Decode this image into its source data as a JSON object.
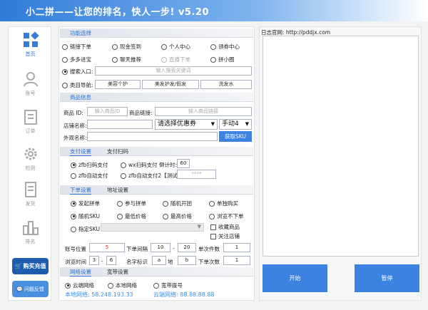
{
  "window": {
    "title": "小二拼——让您的排名，快人一步! v5.20"
  },
  "sidebar": {
    "items": [
      {
        "label": "首页",
        "icon": "home-grid-icon"
      },
      {
        "label": "账号",
        "icon": "user-icon"
      },
      {
        "label": "订单",
        "icon": "order-icon"
      },
      {
        "label": "检测",
        "icon": "gear-icon"
      },
      {
        "label": "发货",
        "icon": "document-icon"
      },
      {
        "label": "排名",
        "icon": "ranking-icon"
      }
    ],
    "buy_button": "购买充值",
    "feedback_button": "问题反馈"
  },
  "function_section": {
    "title": "功能选择",
    "options": [
      "链接下单",
      "现金签到",
      "个人中心",
      "领券中心",
      "多多进宝",
      "聊天推荐",
      "直播下单",
      "拼小圈"
    ],
    "search_entry_label": "搜索入口:",
    "search_placeholder": "输入搜索关键词",
    "category_nav_label": "类目导航:",
    "category_buttons": [
      "美容个护",
      "美发护发/假发",
      "洗发水"
    ]
  },
  "product_section": {
    "title": "商品信息",
    "product_id_label": "商品 ID:",
    "product_id_placeholder": "输入商品ID",
    "product_link_label": "商品链接:",
    "product_link_placeholder": "输入商品链接",
    "store_name_label": "店铺名称:",
    "coupon_select": "请选择优惠券",
    "manual_select": "手动4",
    "appearance_name_label": "外观名称:",
    "get_sku_button": "获取SKU"
  },
  "payment_section": {
    "tabs": [
      "支付设置",
      "支付扫码"
    ],
    "options": [
      "zfb扫码支付",
      "wx扫码支付",
      "zfb自动支付",
      "zfb自动支付2【测试版】"
    ],
    "countdown_label": "倒计时:",
    "countdown_value": "60",
    "password_value": "****"
  },
  "order_section": {
    "tabs": [
      "下单设置",
      "地址设置"
    ],
    "options": [
      "发起拼单",
      "参与拼单",
      "随机开团",
      "单独购买",
      "随机SKU",
      "最低价格",
      "最高价格",
      "浏览不下单",
      "指定SKU"
    ],
    "checkboxes": [
      "收藏商品",
      "关注店铺"
    ],
    "account_position_label": "账号位置",
    "account_position_value": "5",
    "order_interval_label": "下单间隔",
    "order_interval_from": "10",
    "order_interval_to": "20",
    "orders_per_label": "单次件数",
    "orders_per_value": "1",
    "browse_time_label": "浏览时间",
    "browse_from": "3",
    "browse_to": "6",
    "name_mark_label": "名字标识",
    "name_mark_value": "a",
    "address_label": "地",
    "address_value": "b",
    "order_count_label": "下单次数",
    "order_count_value": "1",
    "dash": "-"
  },
  "network_section": {
    "tabs": [
      "网络设置",
      "宽带设置"
    ],
    "options": [
      "云端网络",
      "本地网络",
      "宽带拨号"
    ],
    "local_ip_label": "本地网络: 58.248.193.33",
    "cloud_ip_label": "云端网络: 88.88.88.88"
  },
  "log_panel": {
    "title": "日志官网: http://pddjx.com",
    "start_button": "开始",
    "pause_button": "暂停"
  }
}
